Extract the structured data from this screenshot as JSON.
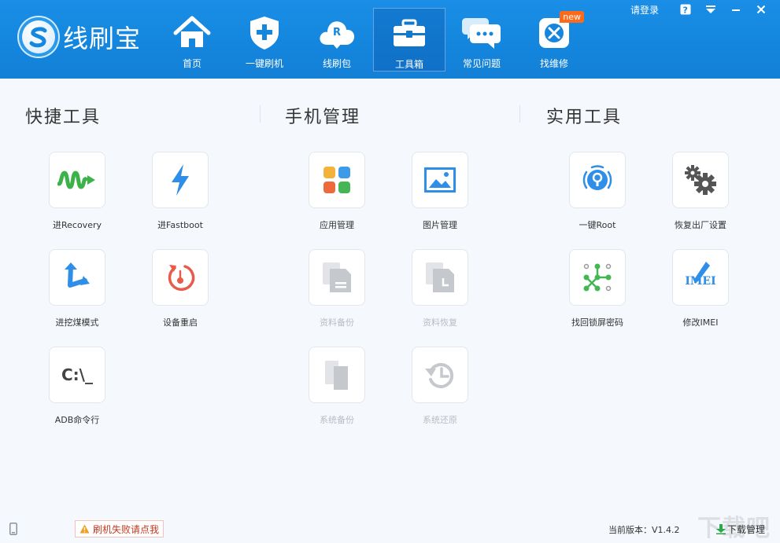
{
  "app": {
    "logo_text": "线刷宝",
    "login_label": "请登录"
  },
  "nav": {
    "items": [
      {
        "label": "首页"
      },
      {
        "label": "一键刷机"
      },
      {
        "label": "线刷包"
      },
      {
        "label": "工具箱"
      },
      {
        "label": "常见问题"
      },
      {
        "label": "找维修",
        "badge": "new"
      }
    ],
    "active_index": 3
  },
  "sections": {
    "quick_tools": {
      "title": "快捷工具",
      "items": [
        {
          "label": "进Recovery"
        },
        {
          "label": "进Fastboot"
        },
        {
          "label": "进挖煤模式"
        },
        {
          "label": "设备重启"
        },
        {
          "label": "ADB命令行",
          "icon_text": "C:\\_"
        }
      ]
    },
    "phone_management": {
      "title": "手机管理",
      "items": [
        {
          "label": "应用管理"
        },
        {
          "label": "图片管理"
        },
        {
          "label": "资料备份",
          "disabled": true
        },
        {
          "label": "资料恢复",
          "disabled": true
        },
        {
          "label": "系统备份",
          "disabled": true
        },
        {
          "label": "系统还原",
          "disabled": true
        }
      ]
    },
    "utility_tools": {
      "title": "实用工具",
      "items": [
        {
          "label": "一键Root"
        },
        {
          "label": "恢复出厂设置"
        },
        {
          "label": "找回锁屏密码"
        },
        {
          "label": "修改IMEI",
          "icon_text": "IMEI"
        }
      ]
    }
  },
  "footer": {
    "flash_fail_label": "刷机失败请点我",
    "version_label": "当前版本：V1.4.2",
    "download_label": "下载管理",
    "watermark": "下载吧"
  },
  "colors": {
    "header_blue": "#1486de",
    "content_bg": "#f5f9fd",
    "recovery_green": "#3db24a",
    "fastboot_blue": "#2e8ee8",
    "restart_red": "#e85b4a",
    "disabled_gray": "#c5c9ce"
  }
}
